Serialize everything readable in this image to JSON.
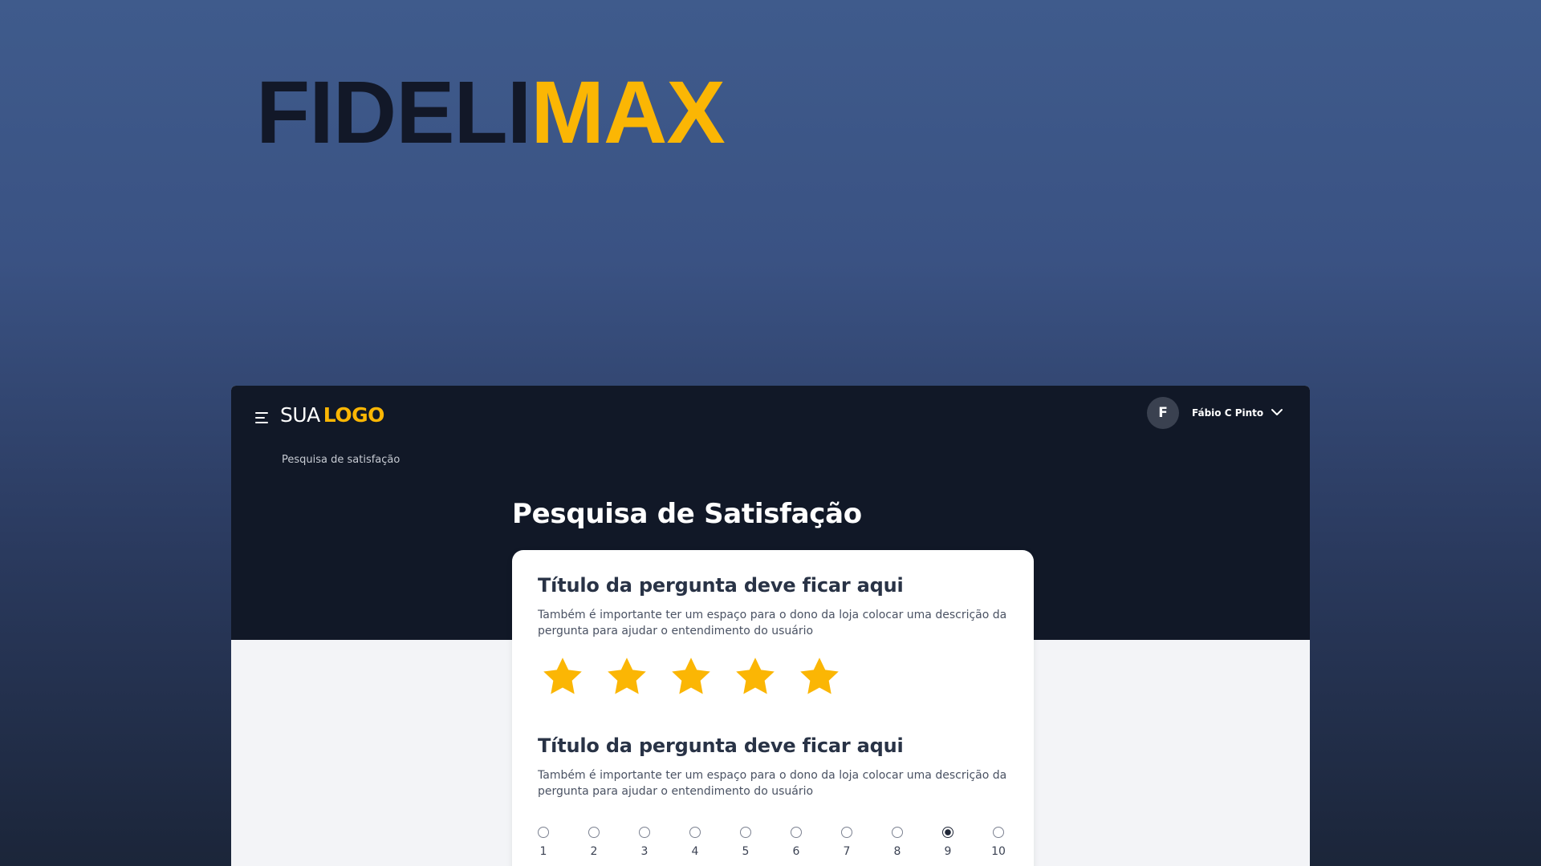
{
  "brand": {
    "part1": "FIDELI",
    "part2": "MAX"
  },
  "header": {
    "logo_thin": "SUA",
    "logo_bold": "LOGO",
    "user_initial": "F",
    "user_name": "Fábio C Pinto"
  },
  "breadcrumb": "Pesquisa de satisfação",
  "page_title": "Pesquisa de Satisfação",
  "questions": [
    {
      "title": "Título da pergunta deve ficar aqui",
      "description": "Também é importante ter um espaço para o dono da loja colocar uma descrição da pergunta para ajudar o entendimento do usuário",
      "type": "stars",
      "stars_total": 5,
      "stars_selected": 5
    },
    {
      "title": "Título da pergunta deve ficar aqui",
      "description": "Também é importante ter um espaço para o dono da loja colocar uma descrição da pergunta para ajudar o entendimento do usuário",
      "type": "scale",
      "options": [
        "1",
        "2",
        "3",
        "4",
        "5",
        "6",
        "7",
        "8",
        "9",
        "10"
      ],
      "selected": "9"
    }
  ],
  "colors": {
    "accent": "#fbb604",
    "header_bg": "#111827",
    "content_bg": "#f3f4f7",
    "card_bg": "#ffffff",
    "title_dark": "#293346"
  },
  "icons": {
    "menu": "menu-icon",
    "chevron": "chevron-down-icon",
    "star": "star-icon"
  }
}
